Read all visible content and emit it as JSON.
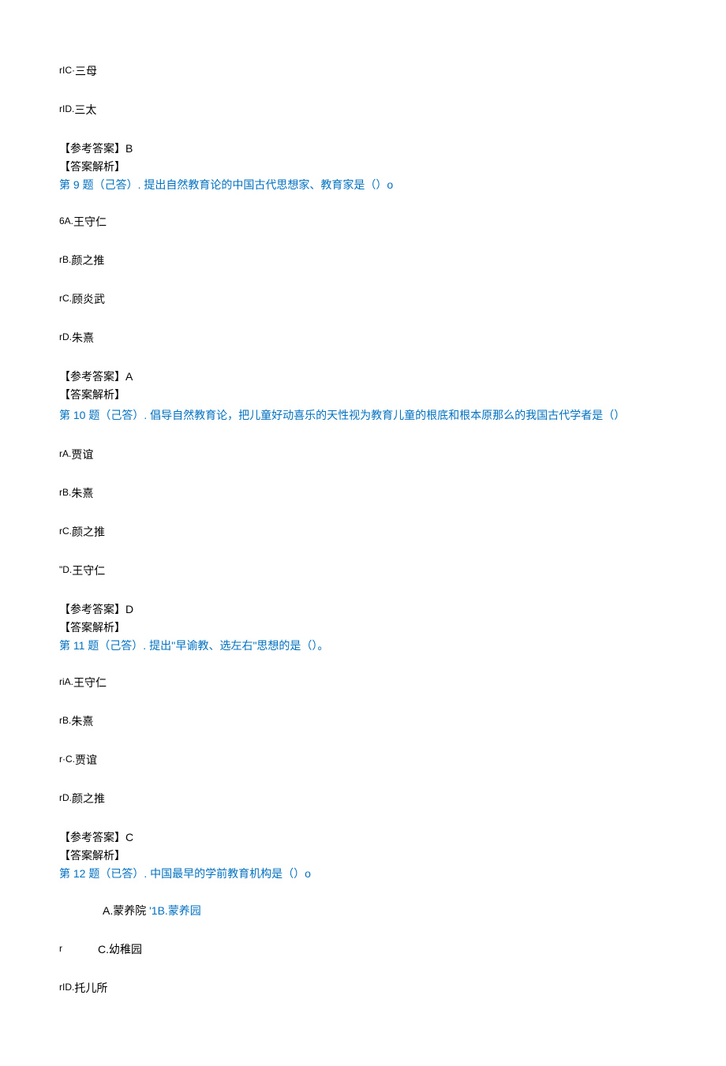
{
  "q8": {
    "option_c_prefix": "rIC·",
    "option_c": "三母",
    "option_d_prefix": "rID.",
    "option_d": "三太",
    "answer_label": "【参考答案】",
    "answer": "B",
    "analysis_label": "【答案解析】"
  },
  "q9": {
    "question_prefix": "第 9 题（己答）. ",
    "question_text": "提出自然教育论的中国古代思想家、教育家是（）o",
    "option_a_prefix": "6A.",
    "option_a": "王守仁",
    "option_b_prefix": "rB.",
    "option_b": "颜之推",
    "option_c_prefix": "rC.",
    "option_c": "顾炎武",
    "option_d_prefix": "rD.",
    "option_d": "朱熹",
    "answer_label": "【参考答案】",
    "answer": "A",
    "analysis_label": "【答案解析】"
  },
  "q10": {
    "question_prefix": "第 10 题（己答）. ",
    "question_text": "倡导自然教育论，把儿童好动喜乐的天性视为教育儿童的根底和根本原那么的我国古代学者是（）",
    "option_a_prefix": "rA.",
    "option_a": "贾谊",
    "option_b_prefix": "rB.",
    "option_b": "朱熹",
    "option_c_prefix": "rC.",
    "option_c": "颜之推",
    "option_d_prefix": "\"D.",
    "option_d": "王守仁",
    "answer_label": "【参考答案】",
    "answer": "D",
    "analysis_label": "【答案解析】"
  },
  "q11": {
    "question_prefix": "第 11 题（己答）. ",
    "question_text": "提出''早谕教、选左右\"思想的是（）。",
    "option_a_prefix": "riA.",
    "option_a": "王守仁",
    "option_b_prefix": "rB.",
    "option_b": "朱熹",
    "option_c_prefix": "r·C.",
    "option_c": "贾谊",
    "option_d_prefix": "rD.",
    "option_d": "颜之推",
    "answer_label": "【参考答案】",
    "answer": "C",
    "analysis_label": "【答案解析】"
  },
  "q12": {
    "question_prefix": "第 12 题（已答）. ",
    "question_text": "中国最早的学前教育机构是（）o",
    "option_a_prefix": "A.",
    "option_a": "蒙养院",
    "option_b_prefix": " '1B.",
    "option_b": "蒙养园",
    "option_c_row_prefix": "r",
    "option_c_prefix": "C.",
    "option_c": "幼稚园",
    "option_d_prefix": "rID.",
    "option_d": "托儿所"
  }
}
